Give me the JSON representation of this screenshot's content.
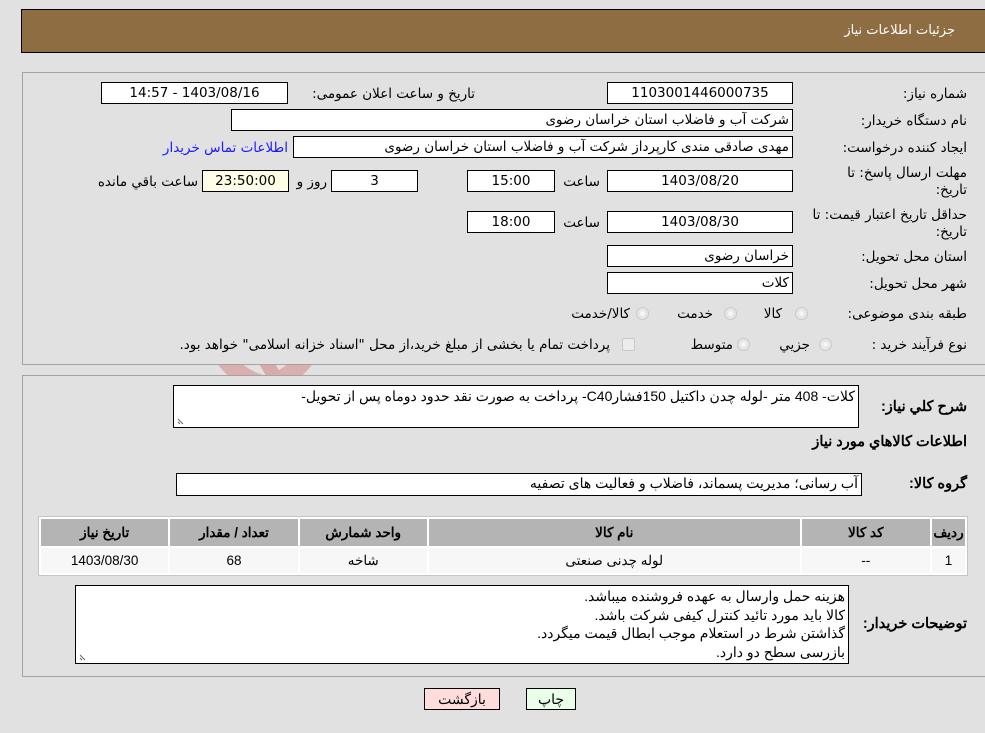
{
  "header": {
    "title": "جزئیات اطلاعات نیاز"
  },
  "details": {
    "need_number": {
      "label": "شماره نیاز:",
      "value": "1103001446000735"
    },
    "announce_datetime": {
      "label": "تاریخ و ساعت اعلان عمومی:",
      "value": "1403/08/16 - 14:57"
    },
    "buyer_org": {
      "label": "نام دستگاه خریدار:",
      "value": "شرکت آب و فاضلاب استان خراسان رضوی"
    },
    "requester": {
      "label": "ایجاد کننده درخواست:",
      "value": "مهدی صادقی مندی کارپرداز شرکت آب و فاضلاب استان خراسان رضوی"
    },
    "buyer_contact_link": "اطلاعات تماس خریدار",
    "reply_deadline": {
      "label_line1": "مهلت ارسال پاسخ: تا",
      "label_line2": "تاریخ:",
      "date": "1403/08/20",
      "time_label": "ساعت",
      "time": "15:00",
      "days": "3",
      "days_label": "روز و",
      "remaining": "23:50:00",
      "remaining_label": "ساعت باقي مانده"
    },
    "price_validity": {
      "label_line1": "حداقل تاریخ اعتبار قیمت: تا",
      "label_line2": "تاریخ:",
      "date": "1403/08/30",
      "time_label": "ساعت",
      "time": "18:00"
    },
    "delivery_province": {
      "label": "استان محل تحویل:",
      "value": "خراسان رضوی"
    },
    "delivery_city": {
      "label": "شهر محل تحویل:",
      "value": "کلات"
    },
    "category": {
      "label": "طبقه بندی موضوعی:",
      "options": [
        "کالا",
        "خدمت",
        "کالا/خدمت"
      ]
    },
    "purchase_type": {
      "label": "نوع فرآیند خرید :",
      "options": [
        "جزيي",
        "متوسط"
      ],
      "treasury_note": "پرداخت تمام یا بخشی از مبلغ خرید،از محل \"اسناد خزانه اسلامی\" خواهد بود."
    }
  },
  "summary": {
    "label": "شرح کلي نیاز:",
    "value": "کلات- 408 متر -لوله چدن داکتیل 150فشارC40- پرداخت به صورت نقد حدود دوماه پس از تحویل-"
  },
  "goods_section_title": "اطلاعات کالاهاي مورد نیاز",
  "goods_group": {
    "label": "گروه کالا:",
    "value": "آب رسانی؛ مدیریت پسماند، فاضلاب و فعالیت های تصفیه"
  },
  "items_table": {
    "columns": [
      "ردیف",
      "کد کالا",
      "نام کالا",
      "واحد شمارش",
      "تعداد / مقدار",
      "تاریخ نیاز"
    ],
    "rows": [
      [
        "1",
        "--",
        "لوله چدنی صنعتی",
        "شاخه",
        "68",
        "1403/08/30"
      ]
    ]
  },
  "buyer_notes": {
    "label": "توضیحات خریدار:",
    "lines": [
      "هزینه حمل وارسال به عهده فروشنده میباشد.",
      "کالا باید مورد تائید کنترل کیفی شرکت باشد.",
      "گذاشتن شرط در استعلام موجب ابطال قیمت میگردد.",
      "بازرسی سطح دو دارد."
    ]
  },
  "buttons": {
    "print": "چاپ",
    "back": "بازگشت"
  },
  "watermark": {
    "text": "AriaTender.neT"
  },
  "colors": {
    "header_bg": "#8e6d42",
    "link": "#1a1aff",
    "back_btn_bg": "#ffdddd",
    "print_btn_bg": "#eaffea",
    "remaining_bg": "#fefee6"
  }
}
